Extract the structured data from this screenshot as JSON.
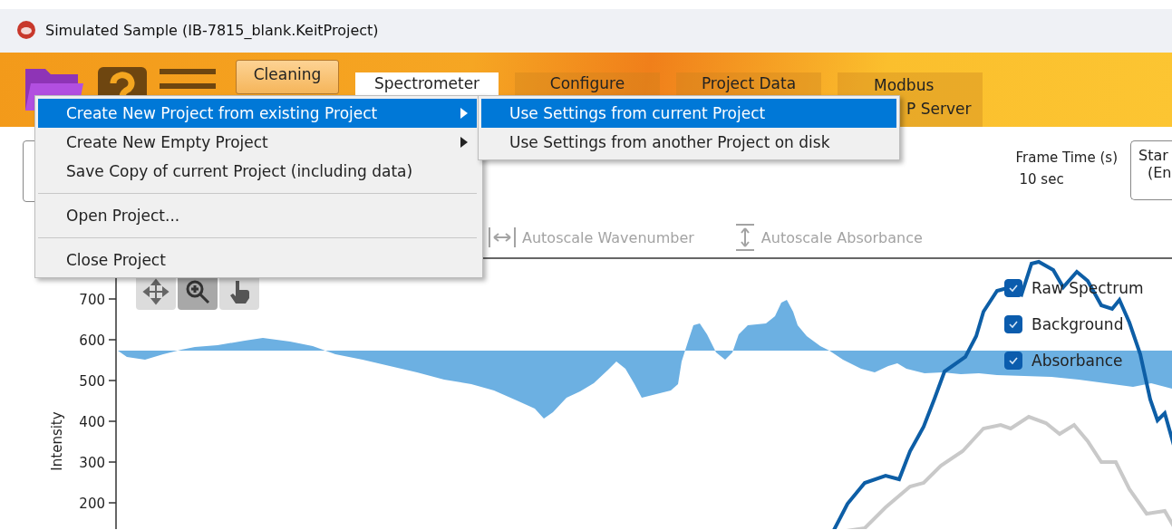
{
  "window": {
    "title": "Simulated Sample (IB-7815_blank.KeitProject)"
  },
  "ribbon": {
    "cleaning_button": "Cleaning",
    "tabs": [
      {
        "lines": [
          "Spectrometer"
        ],
        "selected": true
      },
      {
        "lines": [
          "Configure"
        ],
        "selected": false
      },
      {
        "lines": [
          "Project Data"
        ],
        "selected": false
      },
      {
        "lines": [
          "Modbus",
          "P Server"
        ],
        "selected": false
      }
    ]
  },
  "menu": {
    "items": [
      {
        "kind": "item",
        "label": "Create New Project from existing Project",
        "submenu": true,
        "selected": true
      },
      {
        "kind": "item",
        "label": "Create New Empty Project",
        "submenu": true,
        "selected": false
      },
      {
        "kind": "item",
        "label": "Save Copy of current Project (including data)",
        "submenu": false,
        "selected": false
      },
      {
        "kind": "separator"
      },
      {
        "kind": "item",
        "label": "Open Project...",
        "submenu": false,
        "selected": false
      },
      {
        "kind": "separator"
      },
      {
        "kind": "item",
        "label": "Close Project",
        "submenu": false,
        "selected": false
      }
    ],
    "submenu": [
      {
        "label": "Use Settings from current Project",
        "selected": true
      },
      {
        "label": "Use Settings from another Project on disk",
        "selected": false
      }
    ]
  },
  "frame_time": {
    "label": "Frame Time (s)",
    "value": "10 sec"
  },
  "start_box": {
    "lines": [
      "Star",
      "(En"
    ]
  },
  "toolbar": [
    {
      "kind": "wavenumber",
      "label": "Autoscale Wavenumber",
      "disabled": true
    },
    {
      "kind": "absorbance",
      "label": "Autoscale Absorbance",
      "disabled": true
    }
  ],
  "chart": {
    "y_label": "Intensity",
    "y_ticks": [
      "700",
      "600",
      "500",
      "400",
      "300",
      "200"
    ],
    "plot_tools": [
      {
        "kind": "pan",
        "selected": false
      },
      {
        "kind": "zoom",
        "selected": true
      },
      {
        "kind": "point",
        "selected": false
      }
    ],
    "legend": [
      {
        "label": "Raw Spectrum",
        "checked": true
      },
      {
        "label": "Background",
        "checked": true
      },
      {
        "label": "Absorbance",
        "checked": true
      }
    ]
  }
}
